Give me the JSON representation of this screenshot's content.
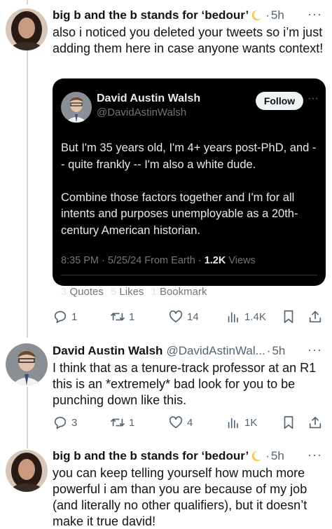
{
  "posts": [
    {
      "name": "big b and the b stands for ‘bedour’",
      "sep": "·",
      "time": "5h",
      "text": "also i noticed you deleted your tweets so i’m just adding them here in case anyone wants context!",
      "actions": {
        "replies": "1",
        "reposts": "1",
        "likes": "14",
        "views": "1.4K"
      }
    },
    {
      "name": "David Austin Walsh",
      "handle": "@DavidAstinWal...",
      "sep": "·",
      "time": "5h",
      "text": "I think that as a tenure-track professor at an R1 this is an *extremely* bad look for you to be punching down like this.",
      "actions": {
        "replies": "3",
        "reposts": "1",
        "likes": "4",
        "views": "1K"
      }
    },
    {
      "name": "big b and the b stands for ‘bedour’",
      "sep": "·",
      "time": "5h",
      "text": "you can keep telling yourself how much more powerful i am than you are because of my job (and literally no other qualifiers), but it doesn’t make it true david!"
    }
  ],
  "embed": {
    "name": "David Austin Walsh",
    "handle": "@DavidAstinWalsh",
    "follow_label": "Follow",
    "text": "But I'm 35 years old, I'm 4+ years post-PhD, and -- quite frankly -- I'm also a white dude.\n\nCombine those factors together and I'm for all intents and purposes unemployable as a 20th-century American historian.",
    "meta_time": "8:35 PM · 5/25/24 From Earth ·",
    "views_count": "1.2K",
    "views_label": "Views",
    "quotes_count": "3",
    "quotes_label": "Quotes",
    "likes_count": "5",
    "likes_label": "Likes",
    "bookmarks_count": "1",
    "bookmarks_label": "Bookmark"
  },
  "icons": {
    "more": "more-icon",
    "reply": "reply-icon",
    "repost": "repost-icon",
    "like": "like-icon",
    "views": "views-icon",
    "bookmark": "bookmark-icon",
    "share": "share-icon",
    "moon": "crescent-moon-emoji"
  },
  "colors": {
    "text": "#0f1419",
    "secondary": "#536471",
    "embed_bg": "#000000",
    "embed_text": "#e7e9ea",
    "thread_line": "#cfd9de"
  }
}
